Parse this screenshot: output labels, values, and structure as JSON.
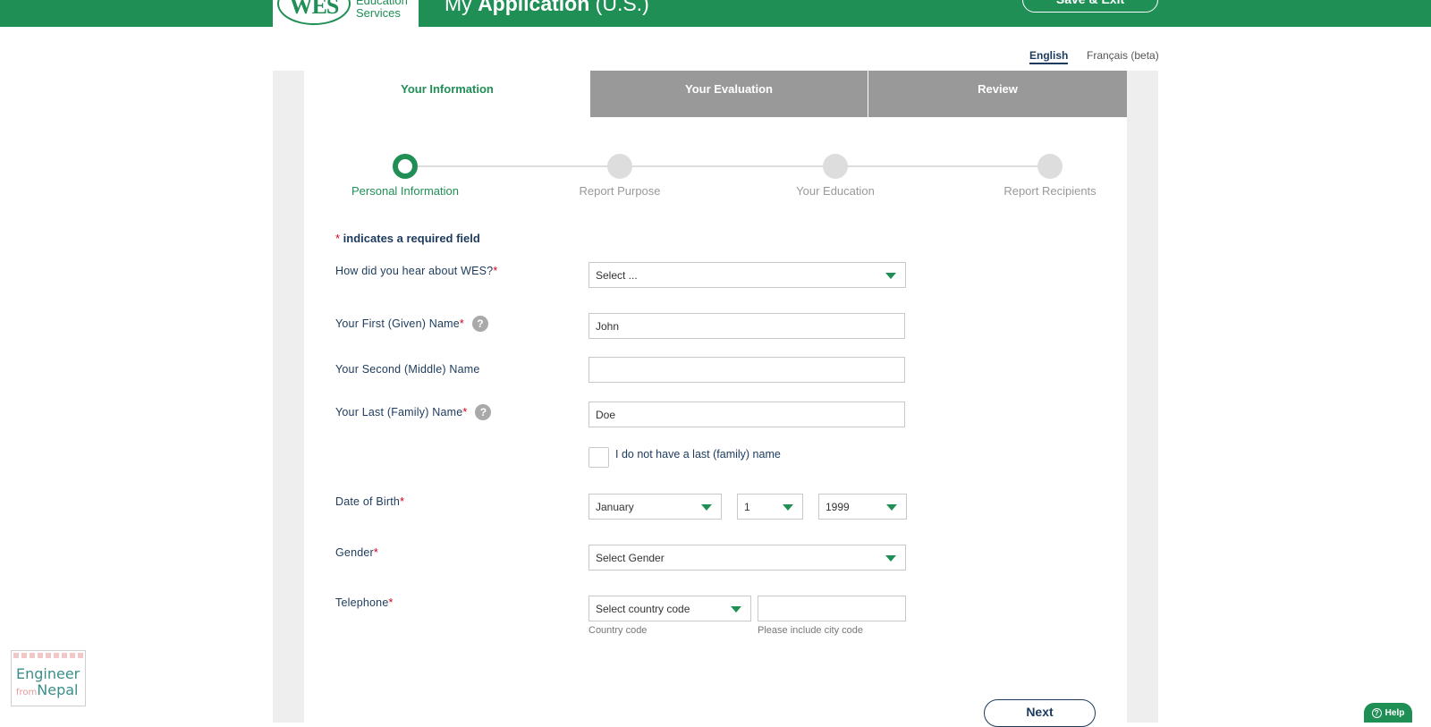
{
  "header": {
    "logo_letters": "WES",
    "logo_line1": "Education",
    "logo_line2": "Services",
    "app_title_pre": "My ",
    "app_title_bold": "Application",
    "app_title_post": " (U.S.)",
    "save_exit_label": "Save & Exit"
  },
  "language": {
    "english": "English",
    "french": "Français (beta)"
  },
  "tabs": [
    {
      "label": "Your Information"
    },
    {
      "label": "Your Evaluation"
    },
    {
      "label": "Review"
    }
  ],
  "steps": [
    {
      "label": "Personal Information"
    },
    {
      "label": "Report Purpose"
    },
    {
      "label": "Your Education"
    },
    {
      "label": "Report Recipients"
    }
  ],
  "form": {
    "required_symbol": "*",
    "required_note": " indicates a required field",
    "hear_label": "How did you hear about WES?",
    "hear_value": "Select ...",
    "first_label": "Your First (Given) Name",
    "first_value": "John",
    "middle_label": "Your Second (Middle) Name",
    "middle_value": "",
    "last_label": "Your Last (Family) Name",
    "last_value": "Doe",
    "help_glyph": "?",
    "no_last_name_label": "I do not have a last (family) name",
    "dob_label": "Date of Birth",
    "dob_month": "January",
    "dob_day": "1",
    "dob_year": "1999",
    "gender_label": "Gender",
    "gender_value": "Select Gender",
    "phone_label": "Telephone",
    "country_code_value": "Select country code",
    "phone_value": "",
    "country_code_hint": "Country code",
    "phone_hint": "Please include city code",
    "next_label": "Next"
  },
  "watermark": {
    "line1": "Engineer",
    "line2_small": "from",
    "line2": "Nepal"
  },
  "help": {
    "glyph": "?",
    "label": "Help"
  },
  "colors": {
    "brand_green": "#1f8f55",
    "navy": "#1c3a5c",
    "required_red": "#d0021b",
    "tab_inactive": "#999999"
  }
}
